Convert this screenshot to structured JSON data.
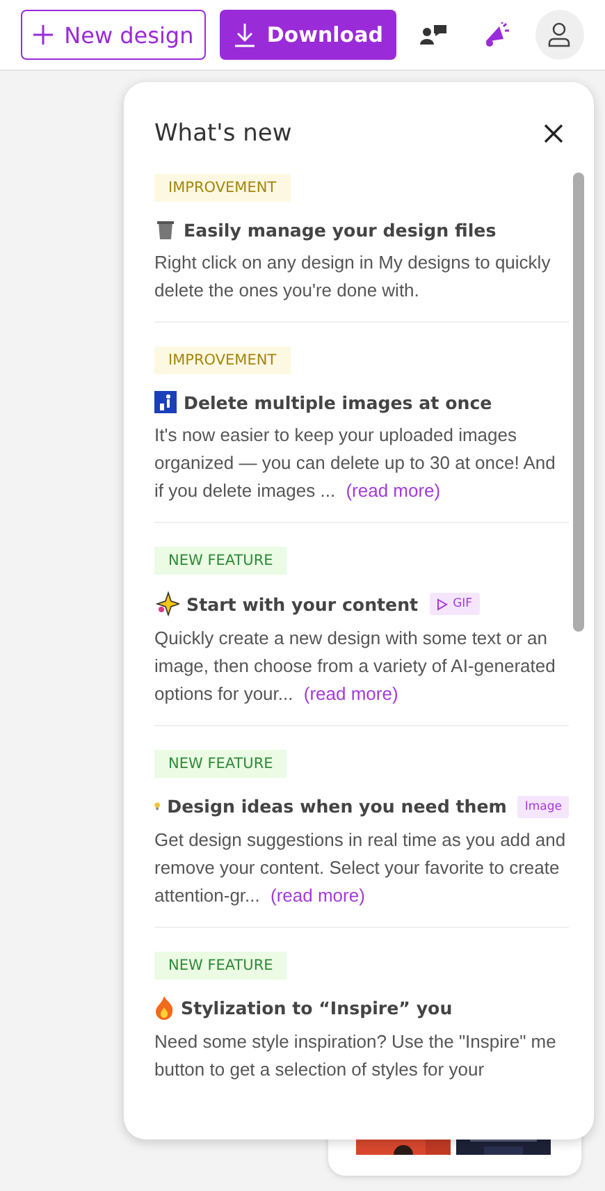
{
  "toolbar": {
    "new_design": "New design",
    "download": "Download"
  },
  "panel": {
    "title": "What's new",
    "items": [
      {
        "tag": "IMPROVEMENT",
        "kind": "improvement",
        "title": "Easily manage your design files",
        "body": "Right click on any design in My designs to quickly delete the ones you're done with."
      },
      {
        "tag": "IMPROVEMENT",
        "kind": "improvement",
        "title": "Delete multiple images at once",
        "body": "It's now easier to keep your uploaded images organized — you can delete up to 30 at once! And if you delete images ...",
        "link": "(read more)"
      },
      {
        "tag": "NEW FEATURE",
        "kind": "feature",
        "title": "Start with your content",
        "media": {
          "kind": "gif",
          "label": "GIF"
        },
        "body": "Quickly create a new design with some text or an image, then choose from a variety of AI-generated options for your...",
        "link": "(read more)"
      },
      {
        "tag": "NEW FEATURE",
        "kind": "feature",
        "title": "Design ideas when you need them",
        "media": {
          "label": "Image"
        },
        "body": "Get design suggestions in real time as you add and remove your content. Select your favorite to create attention-gr...",
        "link": "(read more)"
      },
      {
        "tag": "NEW FEATURE",
        "kind": "feature",
        "title": "Stylization to “Inspire” you",
        "body": "Need some style inspiration? Use the \"Inspire\" me button to get a selection of styles for your"
      }
    ]
  }
}
